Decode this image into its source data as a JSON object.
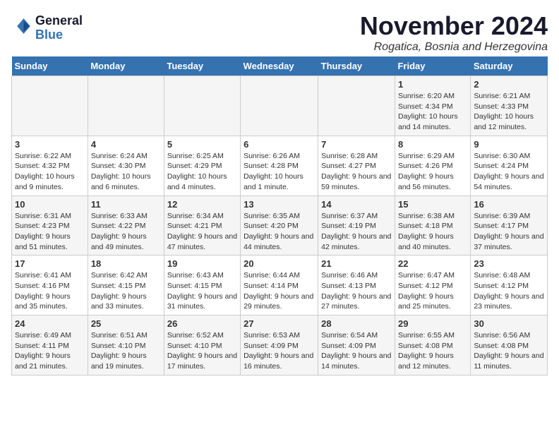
{
  "logo": {
    "line1": "General",
    "line2": "Blue"
  },
  "title": "November 2024",
  "location": "Rogatica, Bosnia and Herzegovina",
  "weekdays": [
    "Sunday",
    "Monday",
    "Tuesday",
    "Wednesday",
    "Thursday",
    "Friday",
    "Saturday"
  ],
  "weeks": [
    [
      {
        "day": "",
        "info": ""
      },
      {
        "day": "",
        "info": ""
      },
      {
        "day": "",
        "info": ""
      },
      {
        "day": "",
        "info": ""
      },
      {
        "day": "",
        "info": ""
      },
      {
        "day": "1",
        "info": "Sunrise: 6:20 AM\nSunset: 4:34 PM\nDaylight: 10 hours and 14 minutes."
      },
      {
        "day": "2",
        "info": "Sunrise: 6:21 AM\nSunset: 4:33 PM\nDaylight: 10 hours and 12 minutes."
      }
    ],
    [
      {
        "day": "3",
        "info": "Sunrise: 6:22 AM\nSunset: 4:32 PM\nDaylight: 10 hours and 9 minutes."
      },
      {
        "day": "4",
        "info": "Sunrise: 6:24 AM\nSunset: 4:30 PM\nDaylight: 10 hours and 6 minutes."
      },
      {
        "day": "5",
        "info": "Sunrise: 6:25 AM\nSunset: 4:29 PM\nDaylight: 10 hours and 4 minutes."
      },
      {
        "day": "6",
        "info": "Sunrise: 6:26 AM\nSunset: 4:28 PM\nDaylight: 10 hours and 1 minute."
      },
      {
        "day": "7",
        "info": "Sunrise: 6:28 AM\nSunset: 4:27 PM\nDaylight: 9 hours and 59 minutes."
      },
      {
        "day": "8",
        "info": "Sunrise: 6:29 AM\nSunset: 4:26 PM\nDaylight: 9 hours and 56 minutes."
      },
      {
        "day": "9",
        "info": "Sunrise: 6:30 AM\nSunset: 4:24 PM\nDaylight: 9 hours and 54 minutes."
      }
    ],
    [
      {
        "day": "10",
        "info": "Sunrise: 6:31 AM\nSunset: 4:23 PM\nDaylight: 9 hours and 51 minutes."
      },
      {
        "day": "11",
        "info": "Sunrise: 6:33 AM\nSunset: 4:22 PM\nDaylight: 9 hours and 49 minutes."
      },
      {
        "day": "12",
        "info": "Sunrise: 6:34 AM\nSunset: 4:21 PM\nDaylight: 9 hours and 47 minutes."
      },
      {
        "day": "13",
        "info": "Sunrise: 6:35 AM\nSunset: 4:20 PM\nDaylight: 9 hours and 44 minutes."
      },
      {
        "day": "14",
        "info": "Sunrise: 6:37 AM\nSunset: 4:19 PM\nDaylight: 9 hours and 42 minutes."
      },
      {
        "day": "15",
        "info": "Sunrise: 6:38 AM\nSunset: 4:18 PM\nDaylight: 9 hours and 40 minutes."
      },
      {
        "day": "16",
        "info": "Sunrise: 6:39 AM\nSunset: 4:17 PM\nDaylight: 9 hours and 37 minutes."
      }
    ],
    [
      {
        "day": "17",
        "info": "Sunrise: 6:41 AM\nSunset: 4:16 PM\nDaylight: 9 hours and 35 minutes."
      },
      {
        "day": "18",
        "info": "Sunrise: 6:42 AM\nSunset: 4:15 PM\nDaylight: 9 hours and 33 minutes."
      },
      {
        "day": "19",
        "info": "Sunrise: 6:43 AM\nSunset: 4:15 PM\nDaylight: 9 hours and 31 minutes."
      },
      {
        "day": "20",
        "info": "Sunrise: 6:44 AM\nSunset: 4:14 PM\nDaylight: 9 hours and 29 minutes."
      },
      {
        "day": "21",
        "info": "Sunrise: 6:46 AM\nSunset: 4:13 PM\nDaylight: 9 hours and 27 minutes."
      },
      {
        "day": "22",
        "info": "Sunrise: 6:47 AM\nSunset: 4:12 PM\nDaylight: 9 hours and 25 minutes."
      },
      {
        "day": "23",
        "info": "Sunrise: 6:48 AM\nSunset: 4:12 PM\nDaylight: 9 hours and 23 minutes."
      }
    ],
    [
      {
        "day": "24",
        "info": "Sunrise: 6:49 AM\nSunset: 4:11 PM\nDaylight: 9 hours and 21 minutes."
      },
      {
        "day": "25",
        "info": "Sunrise: 6:51 AM\nSunset: 4:10 PM\nDaylight: 9 hours and 19 minutes."
      },
      {
        "day": "26",
        "info": "Sunrise: 6:52 AM\nSunset: 4:10 PM\nDaylight: 9 hours and 17 minutes."
      },
      {
        "day": "27",
        "info": "Sunrise: 6:53 AM\nSunset: 4:09 PM\nDaylight: 9 hours and 16 minutes."
      },
      {
        "day": "28",
        "info": "Sunrise: 6:54 AM\nSunset: 4:09 PM\nDaylight: 9 hours and 14 minutes."
      },
      {
        "day": "29",
        "info": "Sunrise: 6:55 AM\nSunset: 4:08 PM\nDaylight: 9 hours and 12 minutes."
      },
      {
        "day": "30",
        "info": "Sunrise: 6:56 AM\nSunset: 4:08 PM\nDaylight: 9 hours and 11 minutes."
      }
    ]
  ]
}
